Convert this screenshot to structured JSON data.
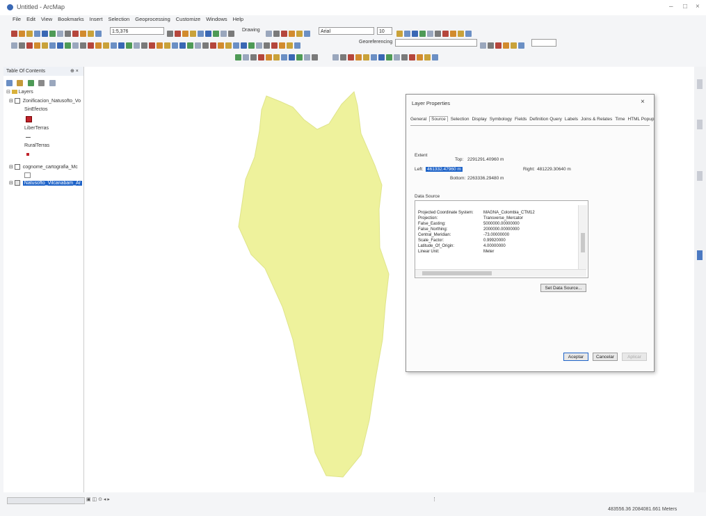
{
  "window": {
    "title": "Untitled - ArcMap"
  },
  "menu": [
    "File",
    "Edit",
    "View",
    "Bookmarks",
    "Insert",
    "Selection",
    "Geoprocessing",
    "Customize",
    "Windows",
    "Help"
  ],
  "toolbar": {
    "scale": "1:5,376",
    "drawing_label": "Drawing",
    "font_name": "Arial",
    "font_size": "10",
    "georeferencing_label": "Georeferencing"
  },
  "toc": {
    "title": "Table Of Contents",
    "root": "Layers",
    "items": [
      "Zonificacion_Natusofto_Vo",
      "SinEfectos",
      "LiberTerras",
      "RuralTerras",
      "cognome_cartografia_Mc",
      "Natusofto_Vilcanabam_Ar"
    ]
  },
  "status": {
    "coords": "483556.36 2084081.661 Meters"
  },
  "dialog": {
    "title": "Layer Properties",
    "close_label": "×",
    "tabs": [
      "General",
      "Source",
      "Selection",
      "Display",
      "Symbology",
      "Fields",
      "Definition Query",
      "Labels",
      "Joins & Relates",
      "Time",
      "HTML Popup"
    ],
    "active_tab": "Source",
    "extent_label": "Extent",
    "top_label": "Top:",
    "top_value": "2291291.40960 m",
    "left_label": "Left:",
    "left_value": "461332.47960 m",
    "right_label": "Right:",
    "right_value": "481229.30640 m",
    "bottom_label": "Bottom:",
    "bottom_value": "2263336.29480 m",
    "datasource_label": "Data Source",
    "properties": [
      {
        "k": "Projected Coordinate System:",
        "v": "MAGNA_Colombia_CTM12"
      },
      {
        "k": "Projection:",
        "v": "Transverse_Mercator"
      },
      {
        "k": "False_Easting:",
        "v": "5000000.00000000"
      },
      {
        "k": "False_Northing:",
        "v": "2000000.00000000"
      },
      {
        "k": "Central_Meridian:",
        "v": "-73.00000000"
      },
      {
        "k": "Scale_Factor:",
        "v": "0.99920000"
      },
      {
        "k": "Latitude_Of_Origin:",
        "v": "4.00000000"
      },
      {
        "k": "Linear Unit:",
        "v": "Meter"
      }
    ],
    "set_source_label": "Set Data Source...",
    "ok_label": "Aceptar",
    "cancel_label": "Cancelar",
    "apply_label": "Aplicar"
  },
  "map": {
    "polygon_color": "#eef29c"
  }
}
